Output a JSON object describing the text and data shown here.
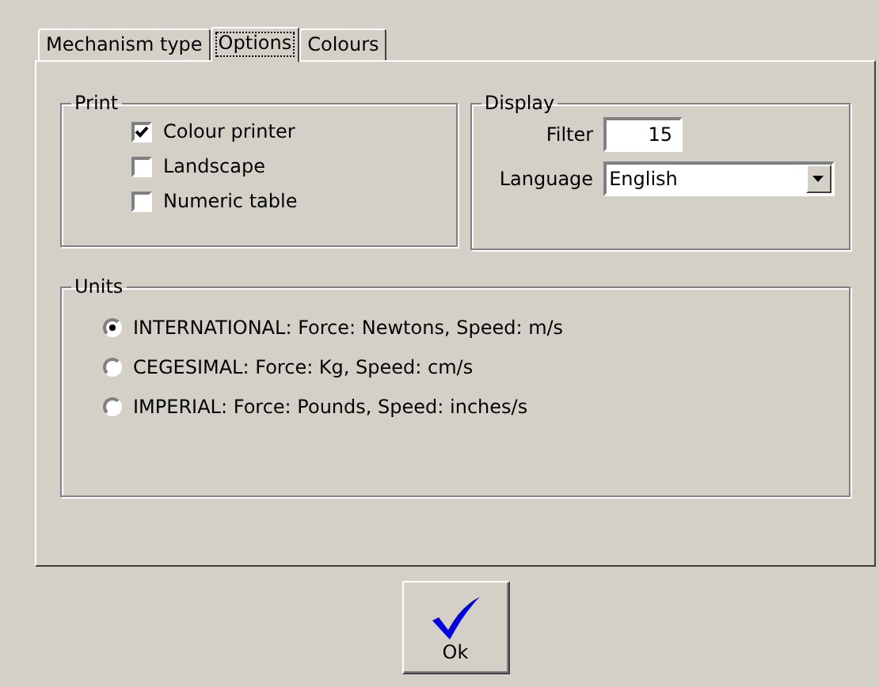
{
  "tabs": [
    {
      "label": "Mechanism type",
      "selected": false
    },
    {
      "label": "Options",
      "selected": true
    },
    {
      "label": "Colours",
      "selected": false
    }
  ],
  "print": {
    "title": "Print",
    "options": [
      {
        "label": "Colour printer",
        "checked": true
      },
      {
        "label": "Landscape",
        "checked": false
      },
      {
        "label": "Numeric table",
        "checked": false
      }
    ]
  },
  "display": {
    "title": "Display",
    "filter": {
      "label": "Filter",
      "value": "15"
    },
    "language": {
      "label": "Language",
      "value": "English"
    }
  },
  "units": {
    "title": "Units",
    "options": [
      {
        "label": "INTERNATIONAL: Force: Newtons, Speed: m/s",
        "selected": true
      },
      {
        "label": "CEGESIMAL: Force: Kg, Speed: cm/s",
        "selected": false
      },
      {
        "label": "IMPERIAL: Force: Pounds, Speed: inches/s",
        "selected": false
      }
    ]
  },
  "ok_button": {
    "label": "Ok"
  }
}
